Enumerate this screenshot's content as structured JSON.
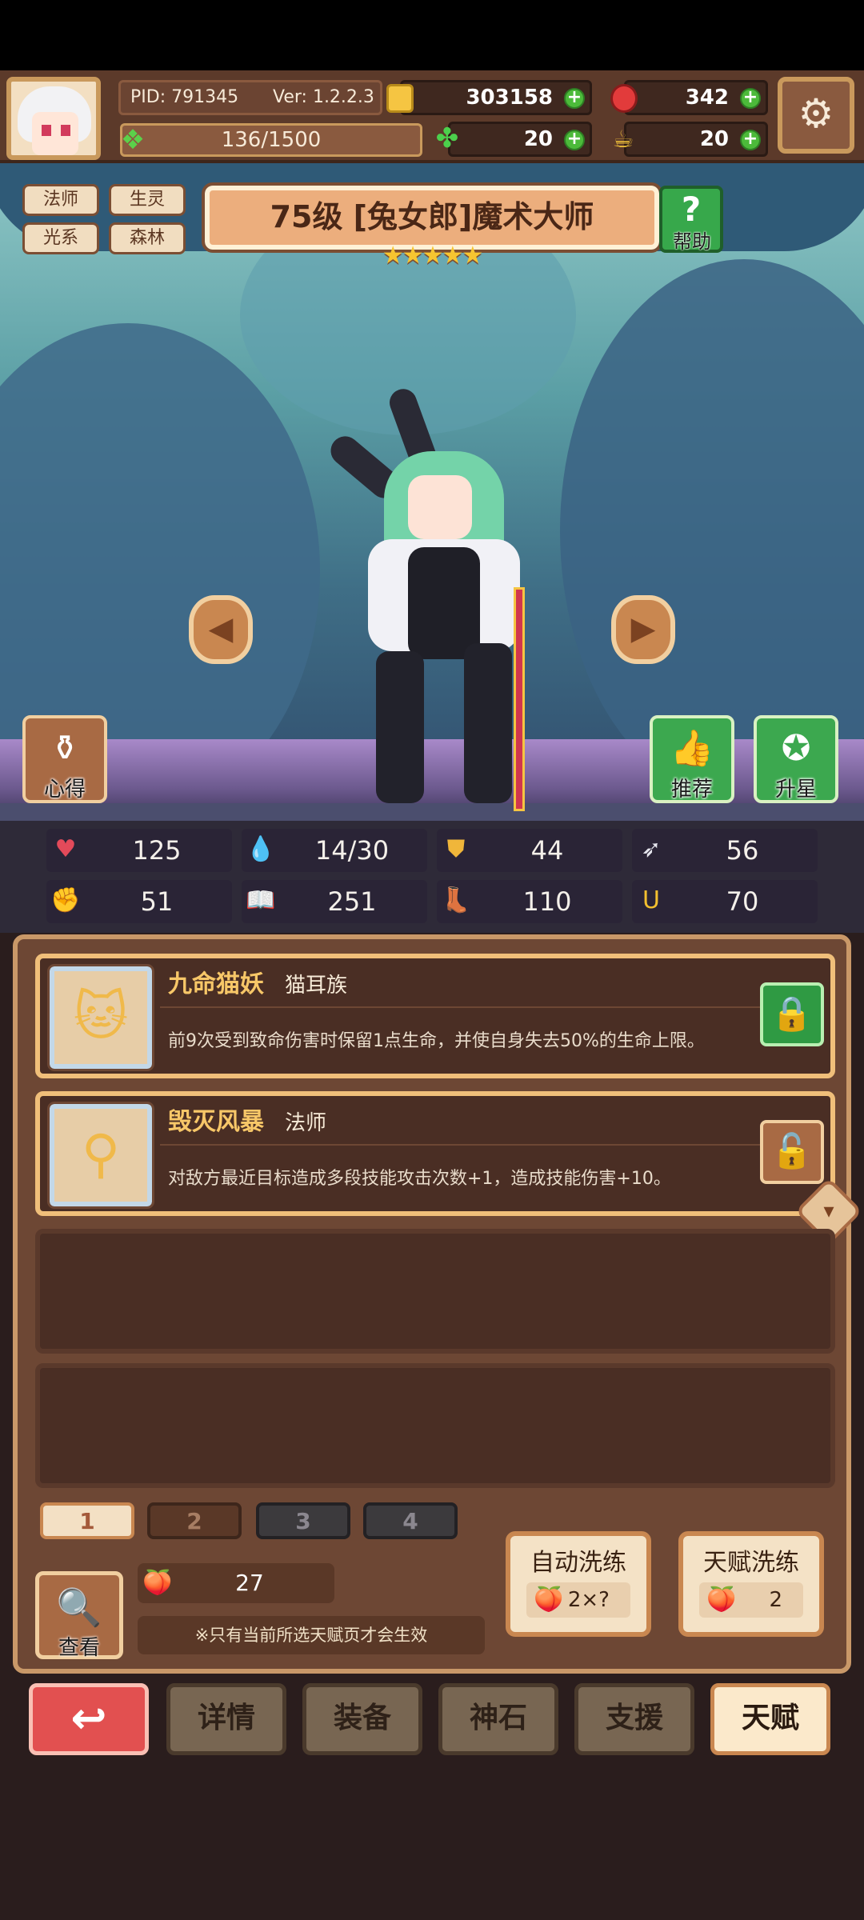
{
  "topbar": {
    "pid": "PID: 791345",
    "version": "Ver: 1.2.2.3",
    "gold": "303158",
    "gems": "342",
    "clover": "20",
    "tea": "20",
    "energy": "136/1500"
  },
  "hero": {
    "tags": [
      "法师",
      "生灵",
      "光系",
      "森林"
    ],
    "title": "75级 [兔女郎]魔术大师",
    "stars": "★★★★★",
    "help_label": "帮助",
    "help_icon": "?",
    "xinde_label": "心得",
    "recommend_label": "推荐",
    "starup_label": "升星"
  },
  "stats": [
    {
      "icon": "heart-icon",
      "glyph": "♥",
      "value": "125"
    },
    {
      "icon": "mana-drop-icon",
      "glyph": "💧",
      "value": "14/30"
    },
    {
      "icon": "shield-icon",
      "glyph": "⛊",
      "value": "44"
    },
    {
      "icon": "wing-icon",
      "glyph": "➶",
      "value": "56"
    },
    {
      "icon": "fist-icon",
      "glyph": "✊",
      "value": "51"
    },
    {
      "icon": "spellbook-icon",
      "glyph": "📖",
      "value": "251"
    },
    {
      "icon": "boot-icon",
      "glyph": "👢",
      "value": "110"
    },
    {
      "icon": "horseshoe-icon",
      "glyph": "Ս",
      "value": "70"
    }
  ],
  "talents": [
    {
      "name": "九命猫妖",
      "kind": "猫耳族",
      "desc": "前9次受到致命伤害时保留1点生命，并使自身失去50%的生命上限。",
      "locked": true
    },
    {
      "name": "毁灭风暴",
      "kind": "法师",
      "desc": "对敌方最近目标造成多段技能攻击次数+1，造成技能伤害+10。",
      "locked": false
    }
  ],
  "pages": [
    "1",
    "2",
    "3",
    "4"
  ],
  "footer": {
    "view_label": "查看",
    "fruit_count": "27",
    "note": "※只有当前所选天赋页才会生效",
    "auto_refine_label": "自动洗练",
    "auto_refine_cost": "2×?",
    "talent_refine_label": "天赋洗练",
    "talent_refine_cost": "2"
  },
  "nav": {
    "back": "↩",
    "details": "详情",
    "equip": "装备",
    "godstone": "神石",
    "support": "支援",
    "talent": "天赋"
  },
  "colors": {
    "accent_gold": "#f7c768",
    "green_button": "#3ca84f",
    "red_button": "#e25050"
  }
}
